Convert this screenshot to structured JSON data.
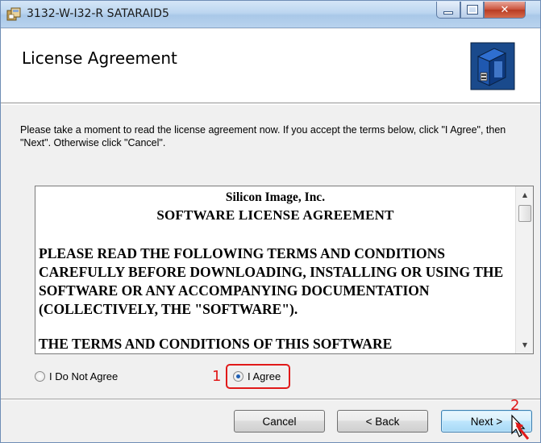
{
  "window": {
    "title": "3132-W-I32-R SATARAID5",
    "controls": [
      "minimize-icon",
      "maximize-icon",
      "close-icon"
    ]
  },
  "header": {
    "title": "License Agreement",
    "graphic": "installer-disk-icon"
  },
  "instructions": "Please take a moment to read the license agreement now. If you accept the terms below, click \"I Agree\", then \"Next\". Otherwise click \"Cancel\".",
  "license": {
    "company": "Silicon Image, Inc.",
    "heading": "SOFTWARE LICENSE AGREEMENT",
    "paragraph1": "PLEASE READ THE FOLLOWING TERMS AND CONDITIONS CAREFULLY BEFORE DOWNLOADING, INSTALLING OR USING THE SOFTWARE OR ANY ACCOMPANYING DOCUMENTATION (COLLECTIVELY, THE \"SOFTWARE\").",
    "paragraph2": "THE TERMS AND CONDITIONS OF THIS SOFTWARE"
  },
  "radios": {
    "not_agree": {
      "label": "I Do Not Agree",
      "checked": false
    },
    "agree": {
      "label": "I Agree",
      "checked": true
    }
  },
  "annotations": {
    "step1": "1",
    "step2": "2",
    "color": "#e11919"
  },
  "buttons": {
    "cancel": "Cancel",
    "back": "< Back",
    "next": "Next >"
  }
}
